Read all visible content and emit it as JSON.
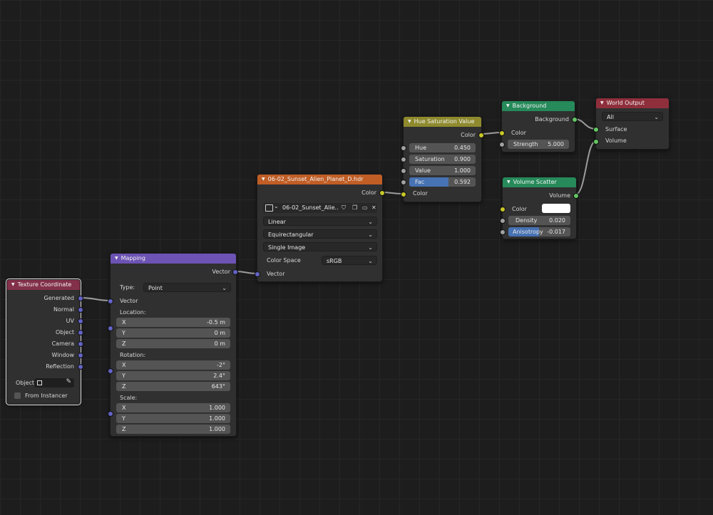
{
  "texture_coordinate": {
    "title": "Texture Coordinate",
    "outputs": [
      "Generated",
      "Normal",
      "UV",
      "Object",
      "Camera",
      "Window",
      "Reflection"
    ],
    "object_label": "Object:",
    "from_instancer": "From Instancer"
  },
  "mapping": {
    "title": "Mapping",
    "output": "Vector",
    "type_label": "Type:",
    "type_value": "Point",
    "vector_label": "Vector",
    "location_label": "Location:",
    "location": [
      {
        "axis": "X",
        "value": "-0.5 m"
      },
      {
        "axis": "Y",
        "value": "0 m"
      },
      {
        "axis": "Z",
        "value": "0 m"
      }
    ],
    "rotation_label": "Rotation:",
    "rotation": [
      {
        "axis": "X",
        "value": "-2°"
      },
      {
        "axis": "Y",
        "value": "2.4°"
      },
      {
        "axis": "Z",
        "value": "643°"
      }
    ],
    "scale_label": "Scale:",
    "scale": [
      {
        "axis": "X",
        "value": "1.000"
      },
      {
        "axis": "Y",
        "value": "1.000"
      },
      {
        "axis": "Z",
        "value": "1.000"
      }
    ]
  },
  "image_texture": {
    "title": "06-02_Sunset_Alien_Planet_D.hdr",
    "output": "Color",
    "image_name": "06-02_Sunset_Alie..",
    "interpolation": "Linear",
    "projection": "Equirectangular",
    "source": "Single Image",
    "color_space_label": "Color Space",
    "color_space": "sRGB",
    "vector_label": "Vector"
  },
  "hue_sat": {
    "title": "Hue Saturation Value",
    "output": "Color",
    "hue_label": "Hue",
    "hue": "0.450",
    "saturation_label": "Saturation",
    "saturation": "0.900",
    "value_label": "Value",
    "value": "1.000",
    "fac_label": "Fac",
    "fac": "0.592",
    "fac_fraction": 0.592,
    "color_label": "Color"
  },
  "background": {
    "title": "Background",
    "output": "Background",
    "color_label": "Color",
    "strength_label": "Strength",
    "strength": "5.000"
  },
  "volume_scatter": {
    "title": "Volume Scatter",
    "output": "Volume",
    "color_label": "Color",
    "density_label": "Density",
    "density": "0.020",
    "anisotropy_label": "Anisotropy",
    "anisotropy": "-0.017",
    "anisotropy_fraction": 0.49
  },
  "world_output": {
    "title": "World Output",
    "target": "All",
    "surface_label": "Surface",
    "volume_label": "Volume"
  },
  "colors": {
    "header_input": "#83314a",
    "header_vector": "#6c53b4",
    "header_texture": "#c05e26",
    "header_color": "#8f8a2e",
    "header_shader": "#268a5a",
    "header_output": "#8f2f3c",
    "link": "#a0a0a0"
  }
}
